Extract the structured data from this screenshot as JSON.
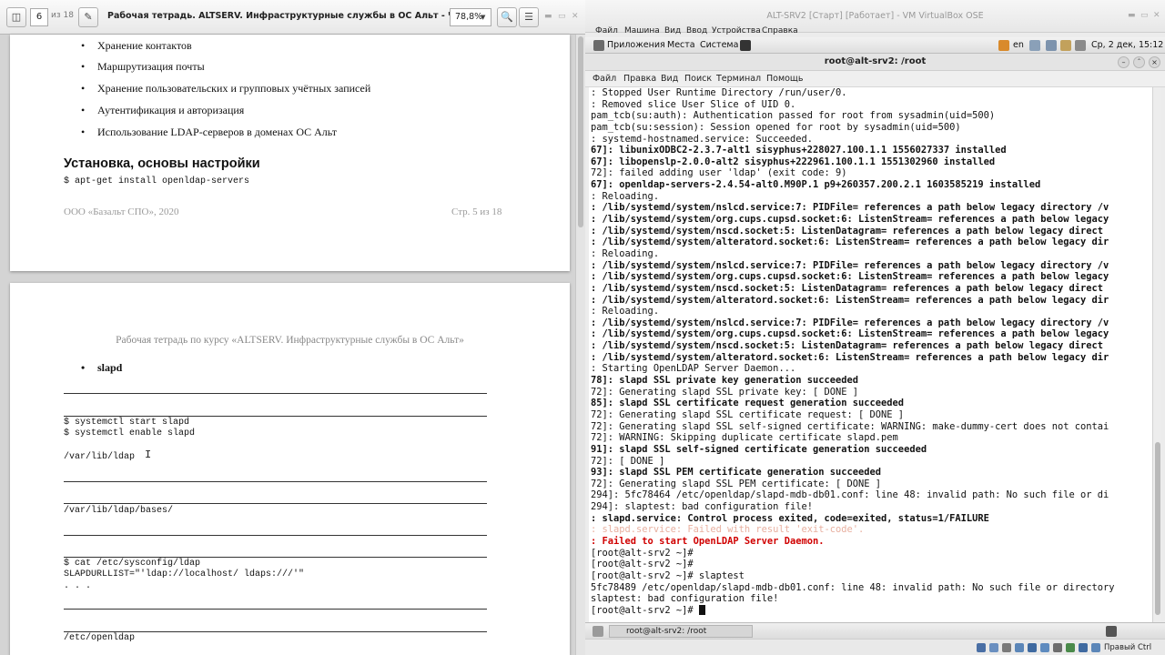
{
  "pdf": {
    "page_current": "6",
    "page_of": "из 18",
    "title": "Рабочая тетрадь. ALTSERV. Инфраструктурные службы в ОС Альт - Часть 3.pdf",
    "zoom": "78,8%",
    "page1": {
      "bullets": [
        "Хранение контактов",
        "Маршрутизация почты",
        "Хранение пользовательских и групповых учётных записей",
        "Аутентификация и авторизация",
        "Использование LDAP-серверов в доменах ОС Альт"
      ],
      "heading": "Установка, основы настройки",
      "install_cmd": "$ apt-get install openldap-servers",
      "footer_left": "ООО «Базальт СПО», 2020",
      "footer_right": "Стр. 5   из 18"
    },
    "page2": {
      "header": "Рабочая тетрадь по курсу «ALTSERV. Инфраструктурные службы в ОС Альт»",
      "bullet": "slapd",
      "cmd_start": "$ systemctl start slapd",
      "cmd_enable": "$ systemctl enable slapd",
      "path_ldap": "/var/lib/ldap",
      "path_bases": "/var/lib/ldap/bases/",
      "cmd_cat": "$ cat /etc/sysconfig/ldap",
      "slapd_urls": "SLAPDURLLIST=\"'ldap://localhost/ ldaps:///'\"",
      "ellipsis": ". . .",
      "path_etc": "/etc/openldap"
    }
  },
  "vbox": {
    "title": "ALT-SRV2 [Старт] [Работает] - VM VirtualBox OSE",
    "menu": [
      "Файл",
      "Машина",
      "Вид",
      "Ввод",
      "Устройства",
      "Справка"
    ],
    "panel": {
      "apps": "Приложения",
      "places": "Места",
      "system": "Система",
      "lang": "en",
      "clock": "Ср, 2 дек, 15:12"
    },
    "terminal": {
      "title": "root@alt-srv2: /root",
      "menu": [
        "Файл",
        "Правка",
        "Вид",
        "Поиск",
        "Терминал",
        "Помощь"
      ],
      "lines": [
        {
          "t": ": Stopped User Runtime Directory /run/user/0.",
          "s": ""
        },
        {
          "t": ": Removed slice User Slice of UID 0.",
          "s": ""
        },
        {
          "t": "pam_tcb(su:auth): Authentication passed for root from sysadmin(uid=500)",
          "s": ""
        },
        {
          "t": "pam_tcb(su:session): Session opened for root by sysadmin(uid=500)",
          "s": ""
        },
        {
          "t": ": systemd-hostnamed.service: Succeeded.",
          "s": ""
        },
        {
          "t": "67]: libunixODBC2-2.3.7-alt1 sisyphus+228027.100.1.1 1556027337 installed",
          "s": "b"
        },
        {
          "t": "67]: libopenslp-2.0.0-alt2 sisyphus+222961.100.1.1 1551302960 installed",
          "s": "b"
        },
        {
          "t": "72]: failed adding user 'ldap' (exit code: 9)",
          "s": ""
        },
        {
          "t": "67]: openldap-servers-2.4.54-alt0.M90P.1 p9+260357.200.2.1 1603585219 installed",
          "s": "b"
        },
        {
          "t": ": Reloading.",
          "s": ""
        },
        {
          "t": ": /lib/systemd/system/nslcd.service:7: PIDFile= references a path below legacy directory /v",
          "s": "b"
        },
        {
          "t": ": /lib/systemd/system/org.cups.cupsd.socket:6: ListenStream= references a path below legacy",
          "s": "b"
        },
        {
          "t": ": /lib/systemd/system/nscd.socket:5: ListenDatagram= references a path below legacy direct",
          "s": "b"
        },
        {
          "t": ": /lib/systemd/system/alteratord.socket:6: ListenStream= references a path below legacy dir",
          "s": "b"
        },
        {
          "t": ": Reloading.",
          "s": ""
        },
        {
          "t": ": /lib/systemd/system/nslcd.service:7: PIDFile= references a path below legacy directory /v",
          "s": "b"
        },
        {
          "t": ": /lib/systemd/system/org.cups.cupsd.socket:6: ListenStream= references a path below legacy",
          "s": "b"
        },
        {
          "t": ": /lib/systemd/system/nscd.socket:5: ListenDatagram= references a path below legacy direct",
          "s": "b"
        },
        {
          "t": ": /lib/systemd/system/alteratord.socket:6: ListenStream= references a path below legacy dir",
          "s": "b"
        },
        {
          "t": ": Reloading.",
          "s": ""
        },
        {
          "t": ": /lib/systemd/system/nslcd.service:7: PIDFile= references a path below legacy directory /v",
          "s": "b"
        },
        {
          "t": ": /lib/systemd/system/org.cups.cupsd.socket:6: ListenStream= references a path below legacy",
          "s": "b"
        },
        {
          "t": ": /lib/systemd/system/nscd.socket:5: ListenDatagram= references a path below legacy direct",
          "s": "b"
        },
        {
          "t": ": /lib/systemd/system/alteratord.socket:6: ListenStream= references a path below legacy dir",
          "s": "b"
        },
        {
          "t": ": Starting OpenLDAP Server Daemon...",
          "s": ""
        },
        {
          "t": "78]: slapd SSL private key generation succeeded",
          "s": "b"
        },
        {
          "t": "72]: Generating slapd SSL private key: [ DONE ]",
          "s": ""
        },
        {
          "t": "85]: slapd SSL certificate request generation succeeded",
          "s": "b"
        },
        {
          "t": "72]: Generating slapd SSL certificate request: [ DONE ]",
          "s": ""
        },
        {
          "t": "72]: Generating slapd SSL self-signed certificate: WARNING: make-dummy-cert does not contai",
          "s": ""
        },
        {
          "t": "72]: WARNING: Skipping duplicate certificate slapd.pem",
          "s": ""
        },
        {
          "t": "91]: slapd SSL self-signed certificate generation succeeded",
          "s": "b"
        },
        {
          "t": "72]: [ DONE ]",
          "s": ""
        },
        {
          "t": "93]: slapd SSL PEM certificate generation succeeded",
          "s": "b"
        },
        {
          "t": "72]: Generating slapd SSL PEM certificate: [ DONE ]",
          "s": ""
        },
        {
          "t": "294]: 5fc78464 /etc/openldap/slapd-mdb-db01.conf: line 48: invalid path: No such file or di",
          "s": ""
        },
        {
          "t": "294]: slaptest: bad configuration file!",
          "s": ""
        },
        {
          "t": ": slapd.service: Control process exited, code=exited, status=1/FAILURE",
          "s": "b"
        },
        {
          "t": ": slapd.service: Failed with result 'exit-code'.",
          "s": "faint"
        },
        {
          "t": ": Failed to start OpenLDAP Server Daemon.",
          "s": "red"
        },
        {
          "t": "[root@alt-srv2 ~]#",
          "s": ""
        },
        {
          "t": "[root@alt-srv2 ~]#",
          "s": ""
        },
        {
          "t": "[root@alt-srv2 ~]# slaptest",
          "s": ""
        },
        {
          "t": "5fc78489 /etc/openldap/slapd-mdb-db01.conf: line 48: invalid path: No such file or directory",
          "s": ""
        },
        {
          "t": "slaptest: bad configuration file!",
          "s": ""
        },
        {
          "t": "[root@alt-srv2 ~]# ",
          "s": "prompt"
        }
      ]
    },
    "taskbar_item": "root@alt-srv2: /root",
    "host_key": "Правый Ctrl"
  },
  "colors": {
    "error_red": "#d00000",
    "terminal_bg": "#ffffff",
    "pdf_footer_gray": "#9a9a9a"
  }
}
